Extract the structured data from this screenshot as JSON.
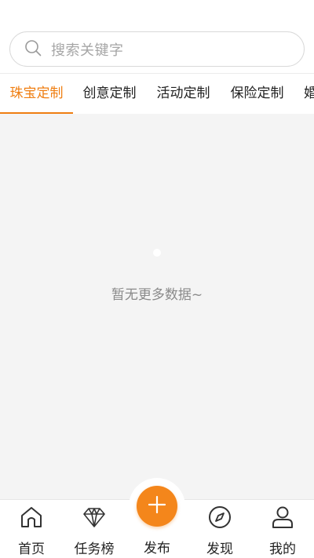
{
  "search": {
    "placeholder": "搜索关键字",
    "icon": "search-icon"
  },
  "tabs": [
    {
      "label": "珠宝定制",
      "active": true
    },
    {
      "label": "创意定制",
      "active": false
    },
    {
      "label": "活动定制",
      "active": false
    },
    {
      "label": "保险定制",
      "active": false
    },
    {
      "label": "婚",
      "active": false
    }
  ],
  "content": {
    "empty_text": "暂无更多数据~"
  },
  "nav": {
    "items": [
      {
        "label": "首页",
        "icon": "home-icon"
      },
      {
        "label": "任务榜",
        "icon": "diamond-icon"
      },
      {
        "label": "发布",
        "icon": "plus-icon"
      },
      {
        "label": "发现",
        "icon": "compass-icon"
      },
      {
        "label": "我的",
        "icon": "user-icon"
      }
    ]
  },
  "colors": {
    "accent": "#ef7e11",
    "publish_button": "#f4861b",
    "background": "#f4f4f4"
  }
}
